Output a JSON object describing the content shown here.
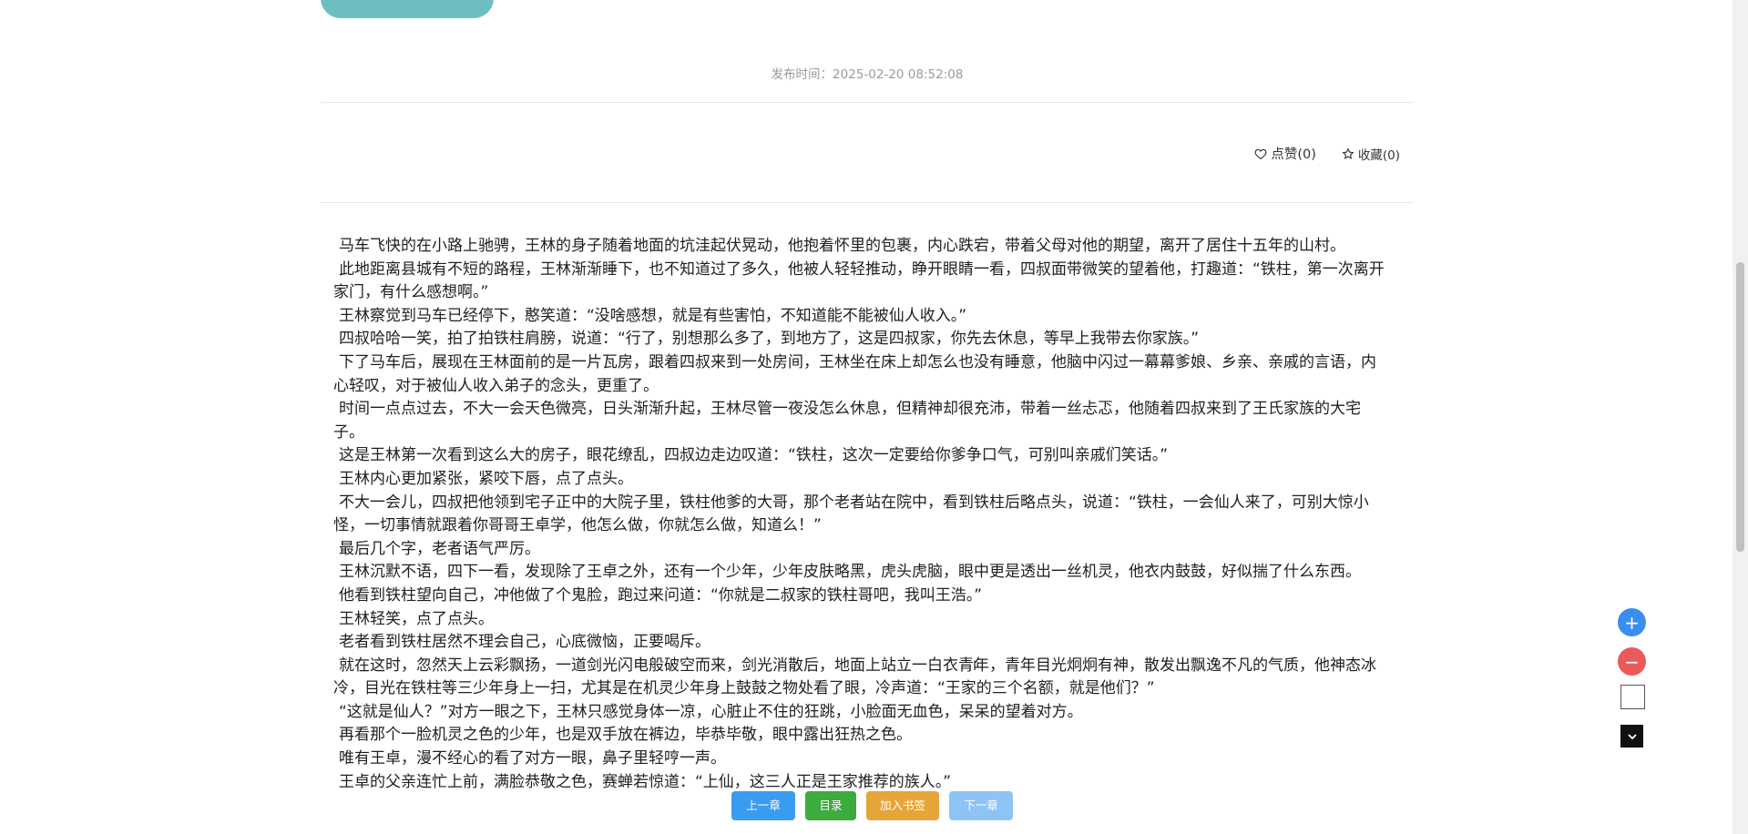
{
  "article": {
    "publish_time": "发布时间：2025-02-20 08:52:08",
    "like_label": "点赞(0)",
    "favorite_label": "收藏(0)",
    "paragraphs": [
      "马车飞快的在小路上驰骋，王林的身子随着地面的坑洼起伏晃动，他抱着怀里的包裹，内心跌宕，带着父母对他的期望，离开了居住十五年的山村。",
      "此地距离县城有不短的路程，王林渐渐睡下，也不知道过了多久，他被人轻轻推动，睁开眼睛一看，四叔面带微笑的望着他，打趣道：“铁柱，第一次离开家门，有什么感想啊。”",
      "王林察觉到马车已经停下，憨笑道：“没啥感想，就是有些害怕，不知道能不能被仙人收入。”",
      "四叔哈哈一笑，拍了拍铁柱肩膀，说道：“行了，别想那么多了，到地方了，这是四叔家，你先去休息，等早上我带去你家族。”",
      "下了马车后，展现在王林面前的是一片瓦房，跟着四叔来到一处房间，王林坐在床上却怎么也没有睡意，他脑中闪过一幕幕爹娘、乡亲、亲戚的言语，内心轻叹，对于被仙人收入弟子的念头，更重了。",
      "时间一点点过去，不大一会天色微亮，日头渐渐升起，王林尽管一夜没怎么休息，但精神却很充沛，带着一丝忐忑，他随着四叔来到了王氏家族的大宅子。",
      "这是王林第一次看到这么大的房子，眼花缭乱，四叔边走边叹道：“铁柱，这次一定要给你爹争口气，可别叫亲戚们笑话。”",
      "王林内心更加紧张，紧咬下唇，点了点头。",
      "不大一会儿，四叔把他领到宅子正中的大院子里，铁柱他爹的大哥，那个老者站在院中，看到铁柱后略点头，说道：“铁柱，一会仙人来了，可别大惊小怪，一切事情就跟着你哥哥王卓学，他怎么做，你就怎么做，知道么！”",
      "最后几个字，老者语气严厉。",
      "王林沉默不语，四下一看，发现除了王卓之外，还有一个少年，少年皮肤略黑，虎头虎脑，眼中更是透出一丝机灵，他衣内鼓鼓，好似揣了什么东西。",
      "他看到铁柱望向自己，冲他做了个鬼脸，跑过来问道：“你就是二叔家的铁柱哥吧，我叫王浩。”",
      "王林轻笑，点了点头。",
      "老者看到铁柱居然不理会自己，心底微恼，正要喝斥。",
      "就在这时，忽然天上云彩飘扬，一道剑光闪电般破空而来，剑光消散后，地面上站立一白衣青年，青年目光炯炯有神，散发出飘逸不凡的气质，他神态冰冷，目光在铁柱等三少年身上一扫，尤其是在机灵少年身上鼓鼓之物处看了眼，冷声道：“王家的三个名额，就是他们？”",
      "“这就是仙人？”对方一眼之下，王林只感觉身体一凉，心脏止不住的狂跳，小脸面无血色，呆呆的望着对方。",
      "再看那个一脸机灵之色的少年，也是双手放在裤边，毕恭毕敬，眼中露出狂热之色。",
      "唯有王卓，漫不经心的看了对方一眼，鼻子里轻哼一声。",
      "王卓的父亲连忙上前，满脸恭敬之色，赛蝉若惊道：“上仙，这三人正是王家推荐的族人。”"
    ]
  },
  "chapter_nav": {
    "prev_label": "上一章",
    "toc_label": "目录",
    "bookmark_label": "加入书签",
    "next_label": "下一章"
  },
  "side_tools": {
    "plus": "+",
    "minus": "−"
  },
  "icons": {
    "like": "heart-icon",
    "favorite": "star-icon"
  }
}
